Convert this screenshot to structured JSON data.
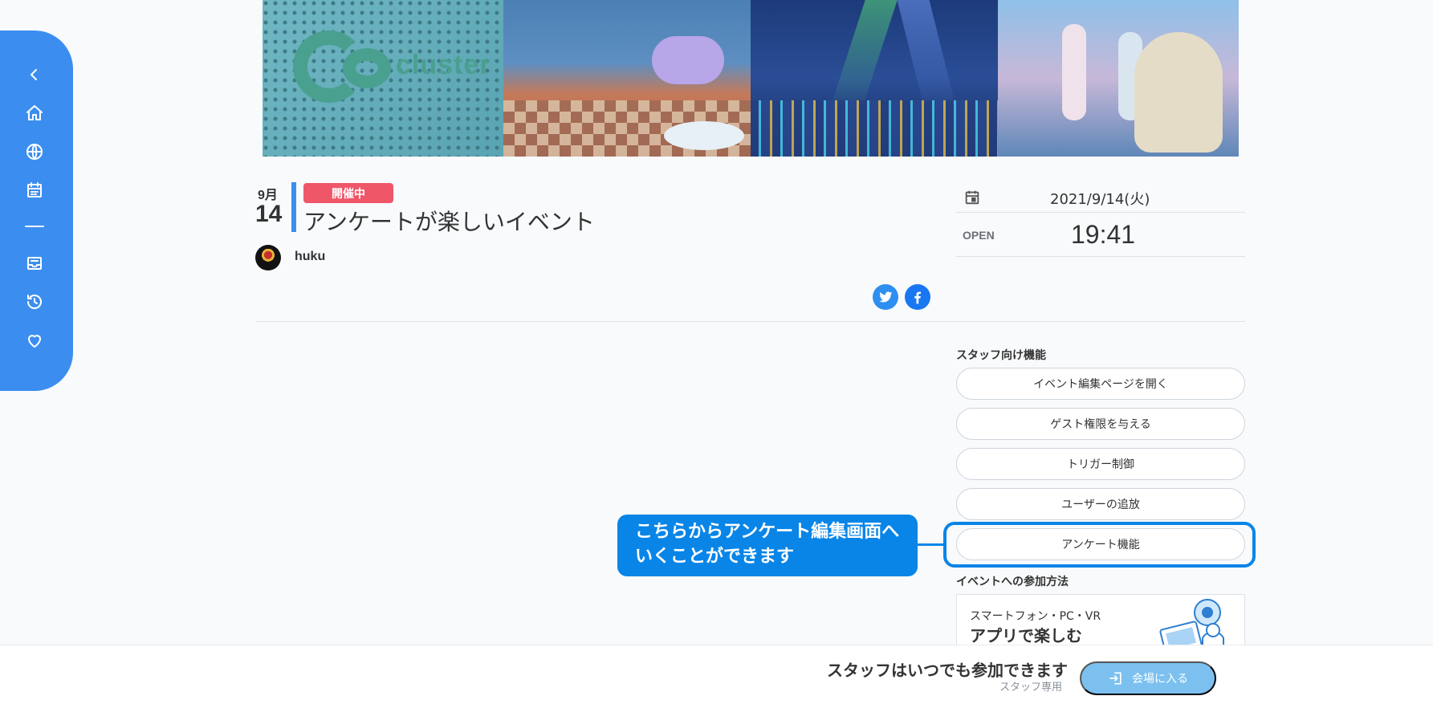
{
  "sidebar": {
    "icons": [
      "chevron-left-icon",
      "home-icon",
      "globe-icon",
      "calendar-icon",
      "dash-icon",
      "inbox-icon",
      "history-icon",
      "heart-icon"
    ]
  },
  "event": {
    "month": "9月",
    "day": "14",
    "status_badge": "開催中",
    "title": "アンケートが楽しいイベント",
    "author": "huku"
  },
  "info": {
    "date": "2021/9/14(火)",
    "open_label": "OPEN",
    "open_time": "19:41"
  },
  "staff": {
    "section_label": "スタッフ向け機能",
    "buttons": [
      "イベント編集ページを開く",
      "ゲスト権限を与える",
      "トリガー制御",
      "ユーザーの追放",
      "アンケート機能"
    ]
  },
  "callout": {
    "line1": "こちらからアンケート編集画面へ",
    "line2": "いくことができます"
  },
  "join": {
    "section_label": "イベントへの参加方法",
    "sub": "スマートフォン・PC・VR",
    "main": "アプリで楽しむ"
  },
  "footer": {
    "main": "スタッフはいつでも参加できます",
    "sub": "スタッフ専用",
    "enter_label": "会場に入る"
  },
  "colors": {
    "accent": "#3b8ef0",
    "badge": "#ef5668",
    "highlight": "#0985e7"
  }
}
